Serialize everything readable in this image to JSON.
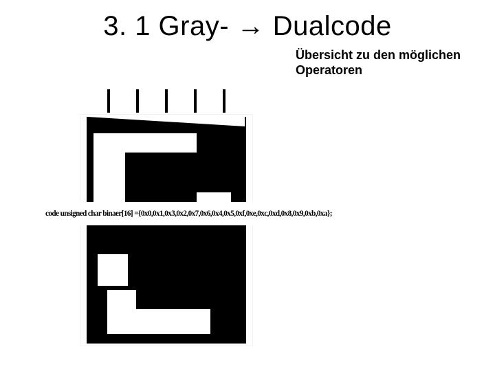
{
  "title": "3. 1 Gray- → Dualcode",
  "subtitle": {
    "line1": "Übersicht zu den möglichen",
    "line2": "Operatoren"
  },
  "code_line": "code unsigned char binaer[16] ={0x0,0x1,0x3,0x2,0x7,0x6,0x4,0x5,0xf,0xe,0xc,0xd,0x8,0x9,0xb,0xa};",
  "figure": {
    "description": "Abstract black-and-white encoder disk / code wheel with 5 input leads",
    "leads": 5
  },
  "colors": {
    "ink": "#000000",
    "paper": "#ffffff"
  }
}
